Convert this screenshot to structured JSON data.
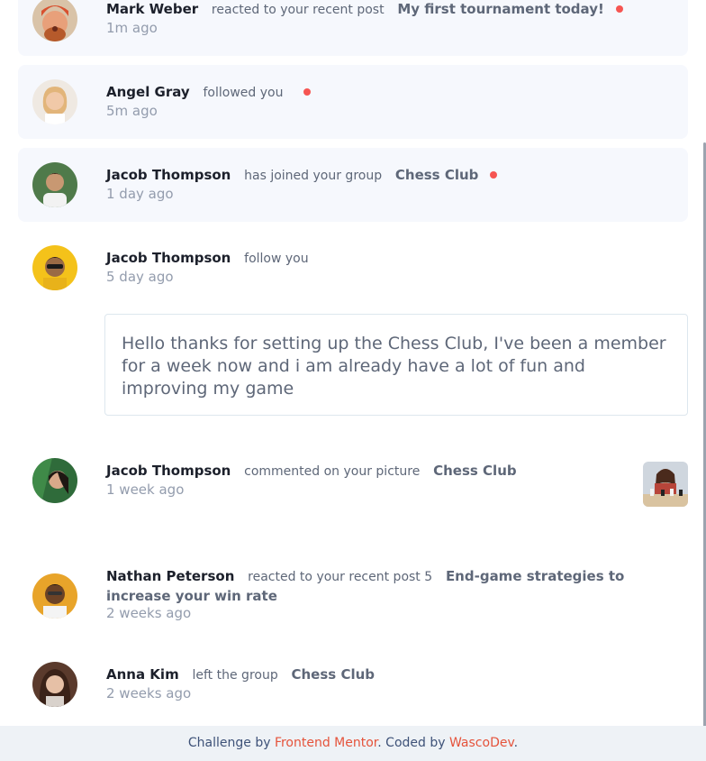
{
  "notifications": [
    {
      "name": "Mark Weber",
      "action": "reacted to your recent post",
      "target": "My first tournament today!",
      "time": "1m ago",
      "unread": true,
      "avatar": "avatar-mark"
    },
    {
      "name": "Angel Gray",
      "action": "followed you",
      "target": "",
      "time": "5m ago",
      "unread": true,
      "avatar": "avatar-angel"
    },
    {
      "name": "Jacob Thompson",
      "action": "has joined your group",
      "target": "Chess Club",
      "time": "1 day ago",
      "unread": true,
      "avatar": "avatar-jacob"
    },
    {
      "name": "Jacob Thompson",
      "action": "follow you",
      "target": "",
      "time": "5 day ago",
      "unread": false,
      "avatar": "avatar-jacob-2"
    },
    {
      "name": "Jacob Thompson",
      "action": "commented on your picture",
      "target": "Chess Club",
      "time": "1 week ago",
      "unread": false,
      "avatar": "avatar-jacob-3"
    },
    {
      "name": "Nathan Peterson",
      "action": "reacted to your recent post 5",
      "target": "End-game strategies to increase your win rate",
      "time": "2 weeks ago",
      "unread": false,
      "avatar": "avatar-nathan"
    },
    {
      "name": "Anna Kim",
      "action": "left the group",
      "target": "Chess Club",
      "time": "2 weeks ago",
      "unread": false,
      "avatar": "avatar-anna"
    }
  ],
  "message": {
    "text": "Hello thanks for setting up the Chess Club, I've been a member for a week now and i am already have a lot of fun and improving my game"
  },
  "footer": {
    "prefix": "Challenge by",
    "link1": "Frontend Mentor",
    "middle": ". Coded by",
    "link2": "WascoDev",
    "suffix": "."
  },
  "colors": {
    "unread_bg": "#f6f8fd",
    "dot": "#f65552",
    "name": "#1c202b",
    "muted": "#5e6778",
    "time": "#939cad",
    "footer_link": "#e5533b"
  }
}
